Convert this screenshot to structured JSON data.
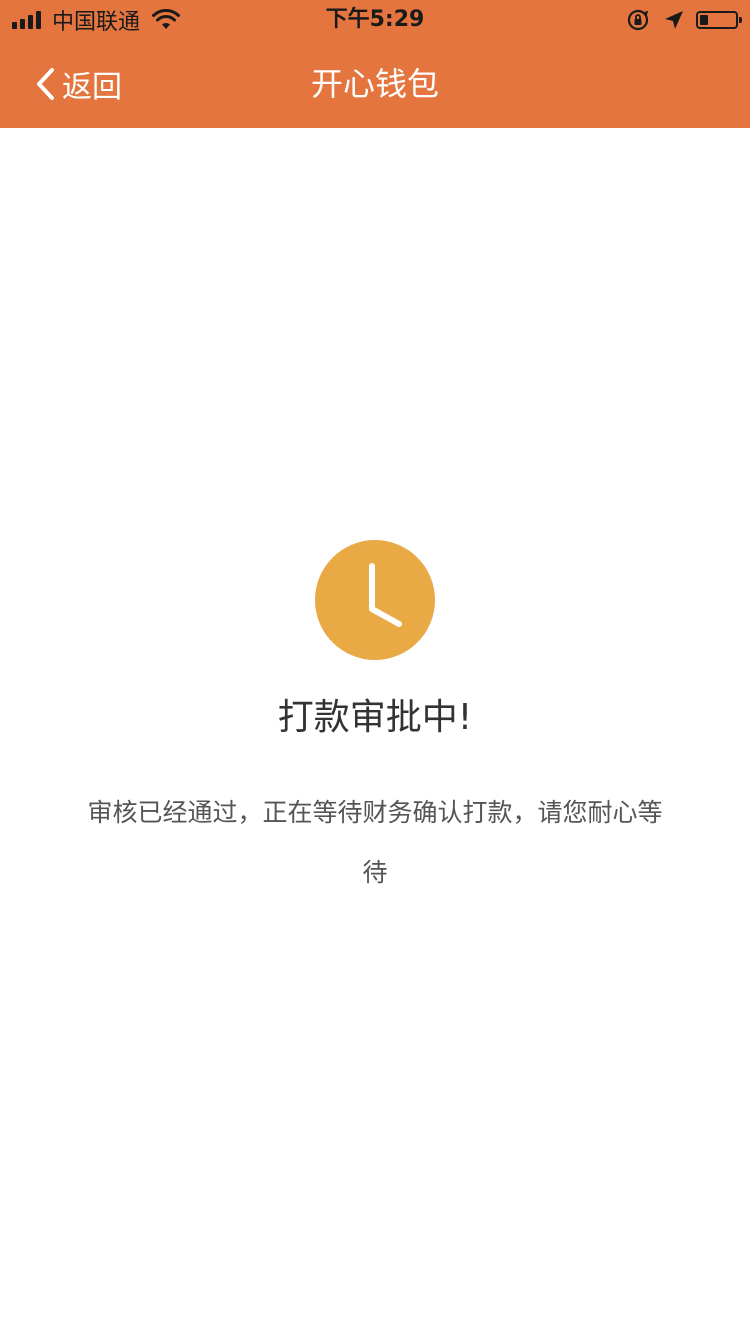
{
  "status_bar": {
    "carrier": "中国联通",
    "time": "下午5:29",
    "icons": [
      "signal-icon",
      "wifi-icon",
      "orientation-lock-icon",
      "location-icon",
      "battery-icon"
    ]
  },
  "nav": {
    "back_label": "返回",
    "title": "开心钱包",
    "background_color": "#E4753E"
  },
  "main": {
    "icon": "clock-icon",
    "icon_color": "#E9A945",
    "title": "打款审批中!",
    "description": "审核已经通过，正在等待财务确认打款，请您耐心等待"
  }
}
